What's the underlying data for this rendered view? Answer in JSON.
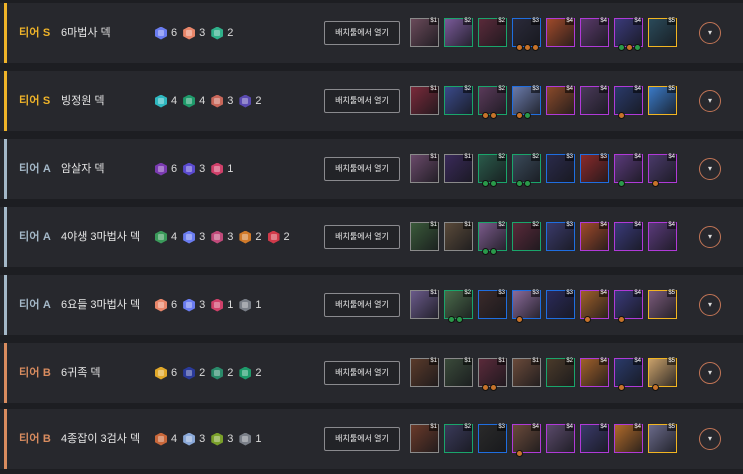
{
  "open_label": "배치툴에서 열기",
  "expand_icon": "▾",
  "colors": {
    "tier_s": "#f0b429",
    "tier_a": "#a4b8c8",
    "tier_b": "#d98c5f"
  },
  "decks": [
    {
      "tier": "티어 S",
      "tier_color": "#f0b429",
      "name": "6마법사 덱",
      "traits": [
        {
          "count": "6",
          "color": "#6a7cf0"
        },
        {
          "count": "3",
          "color": "#e8866a"
        },
        {
          "count": "2",
          "color": "#2fb08a"
        }
      ],
      "champs": [
        {
          "cost": "$1",
          "c": "c1",
          "bg": "#6a4a5a",
          "items": []
        },
        {
          "cost": "$2",
          "c": "c2",
          "bg": "#7a5a9a",
          "items": []
        },
        {
          "cost": "$2",
          "c": "c2",
          "bg": "#5a2a3a",
          "items": []
        },
        {
          "cost": "$3",
          "c": "c3",
          "bg": "#2a2a3a",
          "items": [
            "#c8732a",
            "#c8732a",
            "#c8732a"
          ]
        },
        {
          "cost": "$4",
          "c": "c4",
          "bg": "#a04a2a",
          "items": []
        },
        {
          "cost": "$4",
          "c": "c4",
          "bg": "#5a3a6a",
          "items": []
        },
        {
          "cost": "$4",
          "c": "c4",
          "bg": "#3a3a7a",
          "items": [
            "#2a9a4a",
            "#c8732a",
            "#2a9a4a"
          ]
        },
        {
          "cost": "$5",
          "c": "c5",
          "bg": "#2a4a5a",
          "items": []
        }
      ]
    },
    {
      "tier": "티어 S",
      "tier_color": "#f0b429",
      "name": "빙정원 덱",
      "traits": [
        {
          "count": "4",
          "color": "#2fb8c0"
        },
        {
          "count": "4",
          "color": "#1e9a6a"
        },
        {
          "count": "3",
          "color": "#c8675a"
        },
        {
          "count": "2",
          "color": "#5a4ab0"
        }
      ],
      "champs": [
        {
          "cost": "$1",
          "c": "c1",
          "bg": "#7a2a3a",
          "items": []
        },
        {
          "cost": "$2",
          "c": "c2",
          "bg": "#3a4a8a",
          "items": []
        },
        {
          "cost": "$2",
          "c": "c2",
          "bg": "#5a3a5a",
          "items": [
            "#c8732a",
            "#c8732a"
          ]
        },
        {
          "cost": "$3",
          "c": "c3",
          "bg": "#6a7aaa",
          "items": [
            "#c8732a",
            "#2a9a4a"
          ]
        },
        {
          "cost": "$4",
          "c": "c4",
          "bg": "#8a4a2a",
          "items": []
        },
        {
          "cost": "$4",
          "c": "c4",
          "bg": "#4a3a5a",
          "items": []
        },
        {
          "cost": "$4",
          "c": "c4",
          "bg": "#2a3a6a",
          "items": [
            "#c8732a"
          ]
        },
        {
          "cost": "$5",
          "c": "c5",
          "bg": "#3a7ac8",
          "items": []
        }
      ]
    },
    {
      "tier": "티어 A",
      "tier_color": "#a4b8c8",
      "name": "암살자 덱",
      "traits": [
        {
          "count": "6",
          "color": "#7a3ab0"
        },
        {
          "count": "3",
          "color": "#5a4ad0"
        },
        {
          "count": "1",
          "color": "#d0406a"
        }
      ],
      "champs": [
        {
          "cost": "$1",
          "c": "c1",
          "bg": "#6a4a6a",
          "items": []
        },
        {
          "cost": "$1",
          "c": "c1",
          "bg": "#3a2a5a",
          "items": []
        },
        {
          "cost": "$2",
          "c": "c2",
          "bg": "#2a5a4a",
          "items": [
            "#2a9a4a",
            "#2a9a4a"
          ]
        },
        {
          "cost": "$2",
          "c": "c2",
          "bg": "#3a4a5a",
          "items": [
            "#2a9a4a",
            "#2a9a4a"
          ]
        },
        {
          "cost": "$3",
          "c": "c3",
          "bg": "#2a2a4a",
          "items": []
        },
        {
          "cost": "$3",
          "c": "c3",
          "bg": "#8a2a2a",
          "items": []
        },
        {
          "cost": "$4",
          "c": "c4",
          "bg": "#5a3a7a",
          "items": [
            "#2a9a4a"
          ]
        },
        {
          "cost": "$4",
          "c": "c4",
          "bg": "#4a3a6a",
          "items": [
            "#c8732a"
          ]
        }
      ]
    },
    {
      "tier": "티어 A",
      "tier_color": "#a4b8c8",
      "name": "4야생 3마법사 덱",
      "traits": [
        {
          "count": "4",
          "color": "#3a9a5a"
        },
        {
          "count": "3",
          "color": "#6a7cf0"
        },
        {
          "count": "3",
          "color": "#c04a7a"
        },
        {
          "count": "2",
          "color": "#d07a2a"
        },
        {
          "count": "2",
          "color": "#d03a4a"
        }
      ],
      "champs": [
        {
          "cost": "$1",
          "c": "c1",
          "bg": "#3a5a3a",
          "items": []
        },
        {
          "cost": "$1",
          "c": "c1",
          "bg": "#5a4a3a",
          "items": []
        },
        {
          "cost": "$2",
          "c": "c2",
          "bg": "#7a5a8a",
          "items": [
            "#2a9a4a",
            "#2a9a4a"
          ]
        },
        {
          "cost": "$2",
          "c": "c2",
          "bg": "#5a2a3a",
          "items": []
        },
        {
          "cost": "$3",
          "c": "c3",
          "bg": "#3a3a6a",
          "items": []
        },
        {
          "cost": "$4",
          "c": "c4",
          "bg": "#a04a2a",
          "items": []
        },
        {
          "cost": "$4",
          "c": "c4",
          "bg": "#3a3a7a",
          "items": []
        },
        {
          "cost": "$4",
          "c": "c4",
          "bg": "#5a3a7a",
          "items": []
        }
      ]
    },
    {
      "tier": "티어 A",
      "tier_color": "#a4b8c8",
      "name": "6요들 3마법사 덱",
      "traits": [
        {
          "count": "6",
          "color": "#e8866a"
        },
        {
          "count": "3",
          "color": "#6a7cf0"
        },
        {
          "count": "1",
          "color": "#d0406a"
        },
        {
          "count": "1",
          "color": "#7a7f88"
        }
      ],
      "champs": [
        {
          "cost": "$1",
          "c": "c1",
          "bg": "#6a5a8a",
          "items": []
        },
        {
          "cost": "$2",
          "c": "c2",
          "bg": "#4a6a4a",
          "items": [
            "#2a9a4a",
            "#2a9a4a"
          ]
        },
        {
          "cost": "$3",
          "c": "c3",
          "bg": "#3a2a2a",
          "items": []
        },
        {
          "cost": "$3",
          "c": "c3",
          "bg": "#8a6a9a",
          "items": [
            "#c8732a"
          ]
        },
        {
          "cost": "$3",
          "c": "c3",
          "bg": "#2a2a5a",
          "items": []
        },
        {
          "cost": "$4",
          "c": "c4",
          "bg": "#a0602a",
          "items": [
            "#c8732a"
          ]
        },
        {
          "cost": "$4",
          "c": "c4",
          "bg": "#3a3a7a",
          "items": [
            "#c8732a"
          ]
        },
        {
          "cost": "$5",
          "c": "c5",
          "bg": "#7a5a7a",
          "items": []
        }
      ]
    },
    {
      "tier": "티어 B",
      "tier_color": "#d98c5f",
      "name": "6귀족 덱",
      "traits": [
        {
          "count": "6",
          "color": "#e0a82a"
        },
        {
          "count": "2",
          "color": "#2a3a9a"
        },
        {
          "count": "2",
          "color": "#2a8a6a"
        },
        {
          "count": "2",
          "color": "#1e9a6a"
        }
      ],
      "champs": [
        {
          "cost": "$1",
          "c": "c1",
          "bg": "#5a3a2a",
          "items": []
        },
        {
          "cost": "$1",
          "c": "c1",
          "bg": "#3a4a3a",
          "items": []
        },
        {
          "cost": "$1",
          "c": "c1",
          "bg": "#5a2a3a",
          "items": [
            "#c8732a",
            "#c8732a"
          ]
        },
        {
          "cost": "$1",
          "c": "c1",
          "bg": "#6a4a3a",
          "items": []
        },
        {
          "cost": "$2",
          "c": "c2",
          "bg": "#4a3a2a",
          "items": []
        },
        {
          "cost": "$4",
          "c": "c4",
          "bg": "#a0602a",
          "items": []
        },
        {
          "cost": "$4",
          "c": "c4",
          "bg": "#2a3a6a",
          "items": [
            "#c8732a"
          ]
        },
        {
          "cost": "$5",
          "c": "c5",
          "bg": "#c8a06a",
          "items": [
            "#c8732a"
          ]
        }
      ]
    },
    {
      "tier": "티어 B",
      "tier_color": "#d98c5f",
      "name": "4종잡이 3검사 덱",
      "traits": [
        {
          "count": "4",
          "color": "#c8673a"
        },
        {
          "count": "3",
          "color": "#8aa8d8"
        },
        {
          "count": "3",
          "color": "#7aa02a"
        },
        {
          "count": "1",
          "color": "#7a7f88"
        }
      ],
      "champs": [
        {
          "cost": "$1",
          "c": "c1",
          "bg": "#6a3a2a",
          "items": []
        },
        {
          "cost": "$2",
          "c": "c2",
          "bg": "#3a3a5a",
          "items": []
        },
        {
          "cost": "$3",
          "c": "c3",
          "bg": "#2a2a2a",
          "items": []
        },
        {
          "cost": "$4",
          "c": "c4",
          "bg": "#6a4a3a",
          "items": [
            "#c8732a"
          ]
        },
        {
          "cost": "$4",
          "c": "c4",
          "bg": "#5a4a6a",
          "items": []
        },
        {
          "cost": "$4",
          "c": "c4",
          "bg": "#3a3a6a",
          "items": []
        },
        {
          "cost": "$4",
          "c": "c4",
          "bg": "#b06a2a",
          "items": []
        },
        {
          "cost": "$5",
          "c": "c5",
          "bg": "#6a6a8a",
          "items": []
        }
      ]
    }
  ]
}
